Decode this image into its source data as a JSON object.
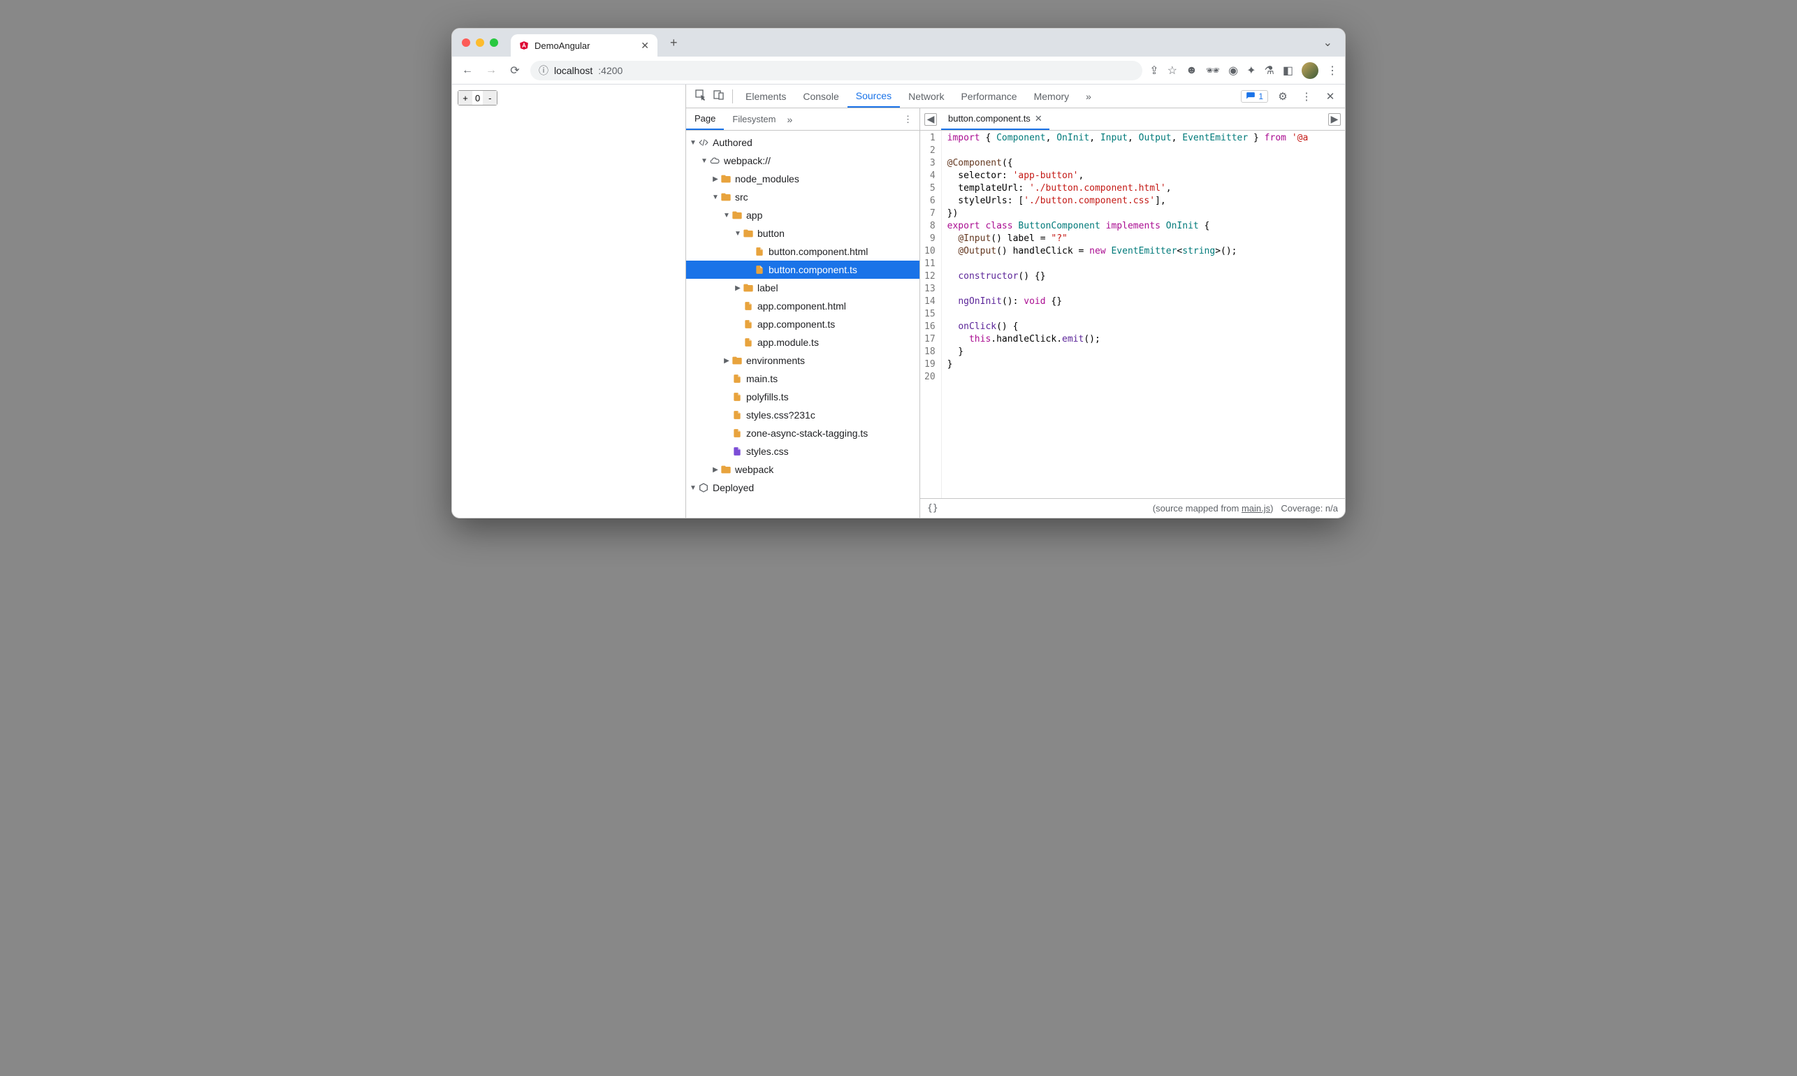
{
  "window": {
    "tab_title": "DemoAngular",
    "url_host": "localhost",
    "url_port": ":4200"
  },
  "page": {
    "counter_value": "0"
  },
  "devtools": {
    "tabs": [
      "Elements",
      "Console",
      "Sources",
      "Network",
      "Performance",
      "Memory"
    ],
    "active_tab": "Sources",
    "more_glyph": "»",
    "issue_count": "1",
    "side_tabs": [
      "Page",
      "Filesystem"
    ],
    "side_active": "Page",
    "side_more": "»"
  },
  "tree": [
    {
      "depth": 0,
      "arrow": "down",
      "icon": "code",
      "label": "Authored"
    },
    {
      "depth": 1,
      "arrow": "down",
      "icon": "cloud",
      "label": "webpack://"
    },
    {
      "depth": 2,
      "arrow": "right",
      "icon": "folder",
      "label": "node_modules"
    },
    {
      "depth": 2,
      "arrow": "down",
      "icon": "folder",
      "label": "src"
    },
    {
      "depth": 3,
      "arrow": "down",
      "icon": "folder",
      "label": "app"
    },
    {
      "depth": 4,
      "arrow": "down",
      "icon": "folder",
      "label": "button"
    },
    {
      "depth": 5,
      "arrow": "",
      "icon": "file",
      "label": "button.component.html"
    },
    {
      "depth": 5,
      "arrow": "",
      "icon": "file",
      "label": "button.component.ts",
      "selected": true
    },
    {
      "depth": 4,
      "arrow": "right",
      "icon": "folder",
      "label": "label"
    },
    {
      "depth": 4,
      "arrow": "",
      "icon": "file",
      "label": "app.component.html"
    },
    {
      "depth": 4,
      "arrow": "",
      "icon": "file",
      "label": "app.component.ts"
    },
    {
      "depth": 4,
      "arrow": "",
      "icon": "file",
      "label": "app.module.ts"
    },
    {
      "depth": 3,
      "arrow": "right",
      "icon": "folder",
      "label": "environments"
    },
    {
      "depth": 3,
      "arrow": "",
      "icon": "file",
      "label": "main.ts"
    },
    {
      "depth": 3,
      "arrow": "",
      "icon": "file",
      "label": "polyfills.ts"
    },
    {
      "depth": 3,
      "arrow": "",
      "icon": "file",
      "label": "styles.css?231c"
    },
    {
      "depth": 3,
      "arrow": "",
      "icon": "file",
      "label": "zone-async-stack-tagging.ts"
    },
    {
      "depth": 3,
      "arrow": "",
      "icon": "file-purple",
      "label": "styles.css"
    },
    {
      "depth": 2,
      "arrow": "right",
      "icon": "folder",
      "label": "webpack"
    },
    {
      "depth": 0,
      "arrow": "down",
      "icon": "cube",
      "label": "Deployed"
    }
  ],
  "editor": {
    "open_file": "button.component.ts",
    "line_count": 20,
    "code_tokens": [
      [
        [
          "kw",
          "import"
        ],
        [
          "",
          " { "
        ],
        [
          "type",
          "Component"
        ],
        [
          "",
          ", "
        ],
        [
          "type",
          "OnInit"
        ],
        [
          "",
          ", "
        ],
        [
          "type",
          "Input"
        ],
        [
          "",
          ", "
        ],
        [
          "type",
          "Output"
        ],
        [
          "",
          ", "
        ],
        [
          "type",
          "EventEmitter"
        ],
        [
          "",
          " } "
        ],
        [
          "kw",
          "from"
        ],
        [
          "",
          " "
        ],
        [
          "str",
          "'@a"
        ]
      ],
      [
        [
          "",
          ""
        ]
      ],
      [
        [
          "dec",
          "@Component"
        ],
        [
          "",
          "({"
        ]
      ],
      [
        [
          "",
          "  selector: "
        ],
        [
          "str",
          "'app-button'"
        ],
        [
          "",
          ","
        ]
      ],
      [
        [
          "",
          "  templateUrl: "
        ],
        [
          "str",
          "'./button.component.html'"
        ],
        [
          "",
          ","
        ]
      ],
      [
        [
          "",
          "  styleUrls: ["
        ],
        [
          "str",
          "'./button.component.css'"
        ],
        [
          "",
          "],"
        ]
      ],
      [
        [
          "",
          "})"
        ]
      ],
      [
        [
          "kw",
          "export"
        ],
        [
          "",
          " "
        ],
        [
          "kw",
          "class"
        ],
        [
          "",
          " "
        ],
        [
          "type",
          "ButtonComponent"
        ],
        [
          "",
          " "
        ],
        [
          "kw",
          "implements"
        ],
        [
          "",
          " "
        ],
        [
          "type",
          "OnInit"
        ],
        [
          "",
          " {"
        ]
      ],
      [
        [
          "",
          "  "
        ],
        [
          "dec",
          "@Input"
        ],
        [
          "",
          "() "
        ],
        [
          "id",
          "label"
        ],
        [
          "",
          " = "
        ],
        [
          "str",
          "\"?\""
        ]
      ],
      [
        [
          "",
          "  "
        ],
        [
          "dec",
          "@Output"
        ],
        [
          "",
          "() "
        ],
        [
          "id",
          "handleClick"
        ],
        [
          "",
          " = "
        ],
        [
          "kw",
          "new"
        ],
        [
          "",
          " "
        ],
        [
          "type",
          "EventEmitter"
        ],
        [
          "",
          "<"
        ],
        [
          "type",
          "string"
        ],
        [
          "",
          ">();"
        ]
      ],
      [
        [
          "",
          ""
        ]
      ],
      [
        [
          "",
          "  "
        ],
        [
          "fn",
          "constructor"
        ],
        [
          "",
          "() {}"
        ]
      ],
      [
        [
          "",
          ""
        ]
      ],
      [
        [
          "",
          "  "
        ],
        [
          "fn",
          "ngOnInit"
        ],
        [
          "",
          "(): "
        ],
        [
          "kw",
          "void"
        ],
        [
          "",
          " {}"
        ]
      ],
      [
        [
          "",
          ""
        ]
      ],
      [
        [
          "",
          "  "
        ],
        [
          "fn",
          "onClick"
        ],
        [
          "",
          "() {"
        ]
      ],
      [
        [
          "",
          "    "
        ],
        [
          "kw",
          "this"
        ],
        [
          "",
          ".handleClick."
        ],
        [
          "fn",
          "emit"
        ],
        [
          "",
          "();"
        ]
      ],
      [
        [
          "",
          "  }"
        ]
      ],
      [
        [
          "",
          "}"
        ]
      ],
      [
        [
          "",
          ""
        ]
      ]
    ]
  },
  "statusbar": {
    "braces": "{}",
    "mapped_prefix": "(source mapped from ",
    "mapped_file": "main.js",
    "mapped_suffix": ")",
    "coverage": "Coverage: n/a"
  }
}
